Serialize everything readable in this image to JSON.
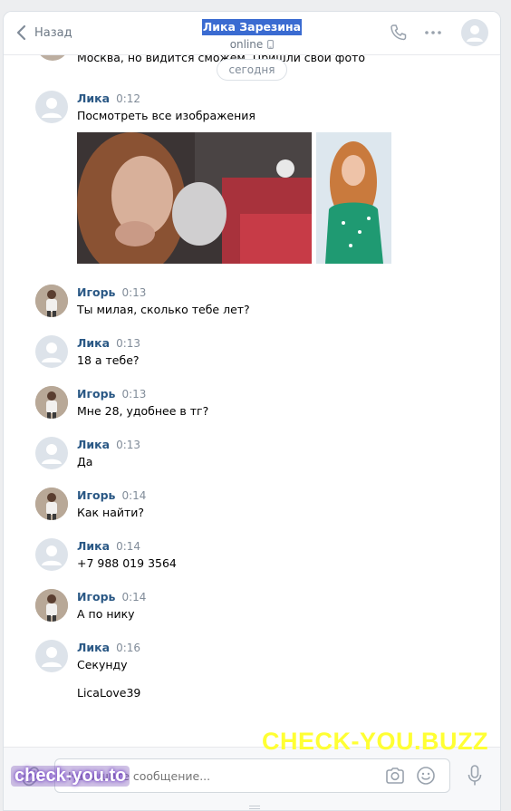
{
  "header": {
    "back_label": "Назад",
    "title": "Лика Зарезина",
    "status": "online"
  },
  "chat": {
    "partial_previous_text": "Москва, но видится сможем. Пришли свои фото",
    "date_divider": "сегодня",
    "show_all_images_link": "Посмотреть все изображения",
    "messages": [
      {
        "author": "Лика",
        "time": "0:12",
        "text": "Посмотреть все изображения"
      },
      {
        "author": "Игорь",
        "time": "0:13",
        "text": "Ты милая, сколько тебе лет?"
      },
      {
        "author": "Лика",
        "time": "0:13",
        "text": "18 а тебе?"
      },
      {
        "author": "Игорь",
        "time": "0:13",
        "text": "Мне 28, удобнее в тг?"
      },
      {
        "author": "Лика",
        "time": "0:13",
        "text": "Да"
      },
      {
        "author": "Игорь",
        "time": "0:14",
        "text": "Как найти?"
      },
      {
        "author": "Лика",
        "time": "0:14",
        "text": "+7 988 019 3564"
      },
      {
        "author": "Игорь",
        "time": "0:14",
        "text": "А по нику"
      },
      {
        "author": "Лика",
        "time": "0:16",
        "text": "Секунду",
        "text2": "LicaLove39"
      }
    ]
  },
  "composer": {
    "placeholder": "Напишите сообщение..."
  },
  "watermarks": {
    "main": "CHECK-YOU.BUZZ",
    "corner": "check-you.to"
  },
  "icons": [
    "chevron-left-icon",
    "phone-icon",
    "more-dots-icon",
    "mobile-icon",
    "paperclip-icon",
    "camera-icon",
    "smile-icon",
    "microphone-icon"
  ],
  "colors": {
    "author_link": "#2a5885",
    "title_highlight": "#3a6bd1",
    "watermark_yellow": "#ffff33"
  }
}
